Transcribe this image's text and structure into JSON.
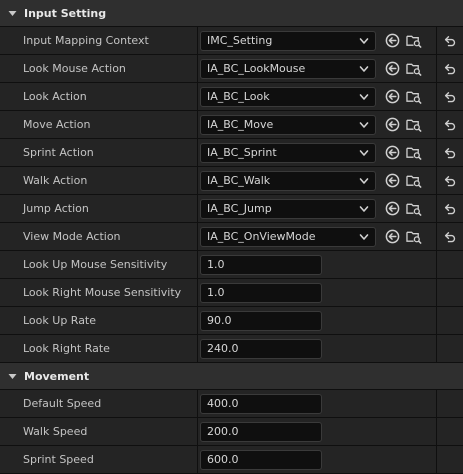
{
  "sections": [
    {
      "title": "Input Setting",
      "rows": [
        {
          "label": "Input Mapping Context",
          "type": "asset",
          "value": "IMC_Setting"
        },
        {
          "label": "Look Mouse Action",
          "type": "asset",
          "value": "IA_BC_LookMouse"
        },
        {
          "label": "Look Action",
          "type": "asset",
          "value": "IA_BC_Look"
        },
        {
          "label": "Move Action",
          "type": "asset",
          "value": "IA_BC_Move"
        },
        {
          "label": "Sprint Action",
          "type": "asset",
          "value": "IA_BC_Sprint"
        },
        {
          "label": "Walk Action",
          "type": "asset",
          "value": "IA_BC_Walk"
        },
        {
          "label": "Jump Action",
          "type": "asset",
          "value": "IA_BC_Jump"
        },
        {
          "label": "View Mode Action",
          "type": "asset",
          "value": "IA_BC_OnViewMode"
        },
        {
          "label": "Look Up Mouse Sensitivity",
          "type": "number",
          "value": "1.0"
        },
        {
          "label": "Look Right Mouse Sensitivity",
          "type": "number",
          "value": "1.0"
        },
        {
          "label": "Look Up Rate",
          "type": "number",
          "value": "90.0"
        },
        {
          "label": "Look Right Rate",
          "type": "number",
          "value": "240.0"
        }
      ]
    },
    {
      "title": "Movement",
      "rows": [
        {
          "label": "Default Speed",
          "type": "number",
          "value": "400.0"
        },
        {
          "label": "Walk Speed",
          "type": "number",
          "value": "200.0"
        },
        {
          "label": "Sprint Speed",
          "type": "number",
          "value": "600.0"
        }
      ]
    }
  ],
  "icons": {
    "expand": "chevron-down-icon",
    "combo": "chevron-down-icon",
    "use_selected": "arrow-left-circle-icon",
    "browse": "folder-search-icon",
    "reset": "reset-arrow-icon"
  },
  "colors": {
    "panel_bg": "#242424",
    "header_bg": "#2f2f2f",
    "input_bg": "#0f0f0f",
    "text": "#c4c4c4"
  }
}
